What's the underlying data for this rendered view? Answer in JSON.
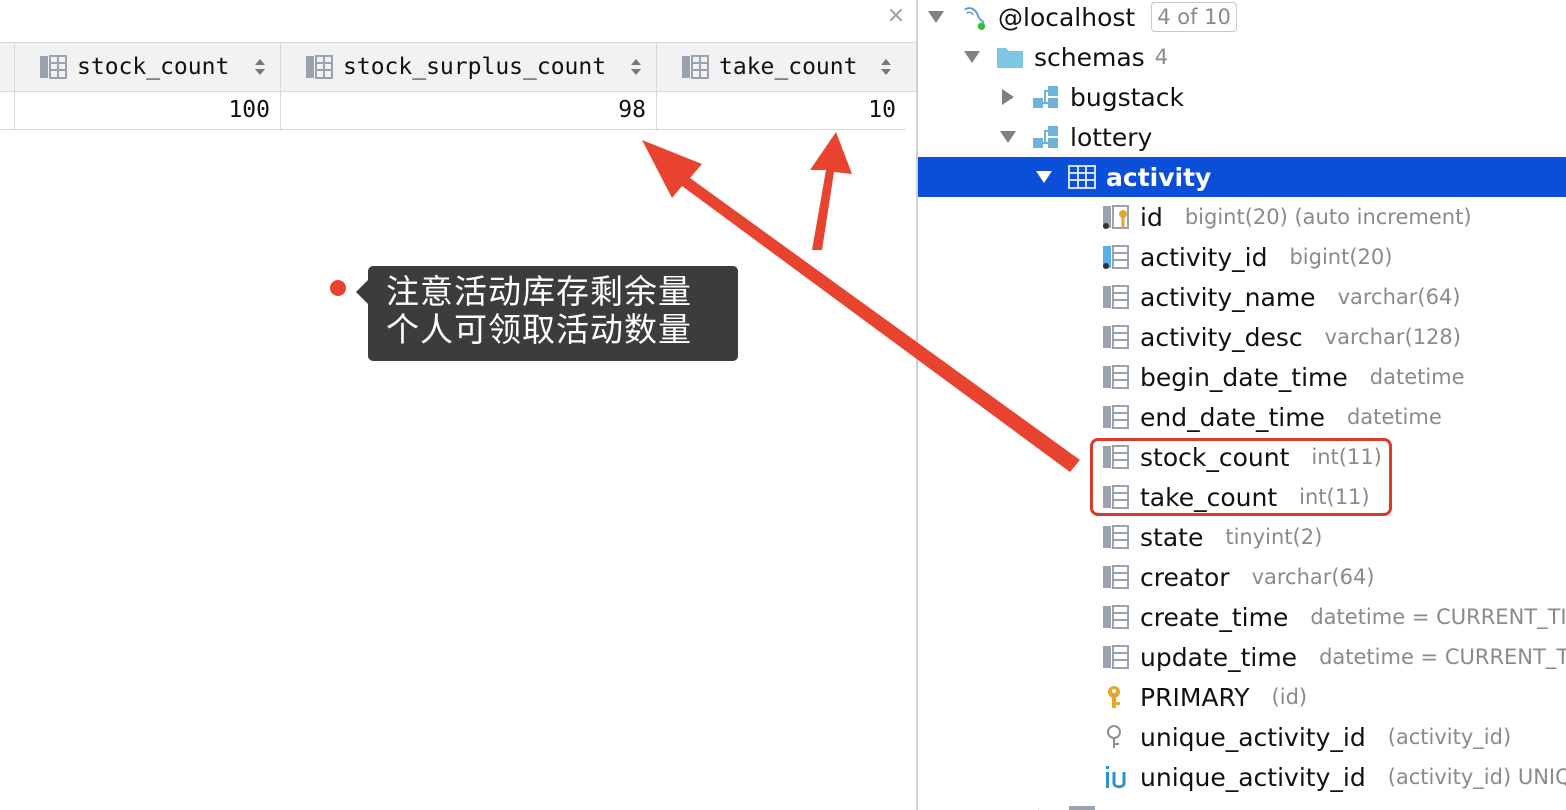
{
  "grid": {
    "columns": [
      {
        "name": "stock_count"
      },
      {
        "name": "stock_surplus_count"
      },
      {
        "name": "take_count"
      }
    ],
    "row": [
      "100",
      "98",
      "10"
    ],
    "close_glyph": "×"
  },
  "callout": {
    "line1": "注意活动库存剩余量",
    "line2": "个人可领取活动数量"
  },
  "tree": {
    "connection": {
      "label": "@localhost",
      "count": "4 of 10"
    },
    "schemas": {
      "label": "schemas",
      "count": "4"
    },
    "schema_items": [
      "bugstack",
      "lottery"
    ],
    "table": "activity",
    "columns": [
      {
        "name": "id",
        "type": "bigint(20) (auto increment)",
        "icon": "primary-key-column-icon"
      },
      {
        "name": "activity_id",
        "type": "bigint(20)",
        "icon": "indexed-column-icon"
      },
      {
        "name": "activity_name",
        "type": "varchar(64)",
        "icon": "column-icon"
      },
      {
        "name": "activity_desc",
        "type": "varchar(128)",
        "icon": "column-icon"
      },
      {
        "name": "begin_date_time",
        "type": "datetime",
        "icon": "column-icon"
      },
      {
        "name": "end_date_time",
        "type": "datetime",
        "icon": "column-icon"
      },
      {
        "name": "stock_count",
        "type": "int(11)",
        "icon": "column-icon"
      },
      {
        "name": "take_count",
        "type": "int(11)",
        "icon": "column-icon"
      },
      {
        "name": "state",
        "type": "tinyint(2)",
        "icon": "column-icon"
      },
      {
        "name": "creator",
        "type": "varchar(64)",
        "icon": "column-icon"
      },
      {
        "name": "create_time",
        "type": "datetime = CURRENT_TIME",
        "icon": "column-icon"
      },
      {
        "name": "update_time",
        "type": "datetime = CURRENT_TI",
        "icon": "column-icon"
      }
    ],
    "keys": [
      {
        "name": "PRIMARY",
        "detail": "(id)",
        "icon": "key-icon"
      },
      {
        "name": "unique_activity_id",
        "detail": "(activity_id)",
        "icon": "key-outline-icon"
      },
      {
        "name": "unique_activity_id",
        "detail": "(activity_id) UNIQ",
        "icon": "unique-index-icon"
      }
    ]
  },
  "colors": {
    "selection": "#0b4ed8",
    "annotation_red": "#e8432e",
    "folder_blue": "#7ec4e4"
  }
}
